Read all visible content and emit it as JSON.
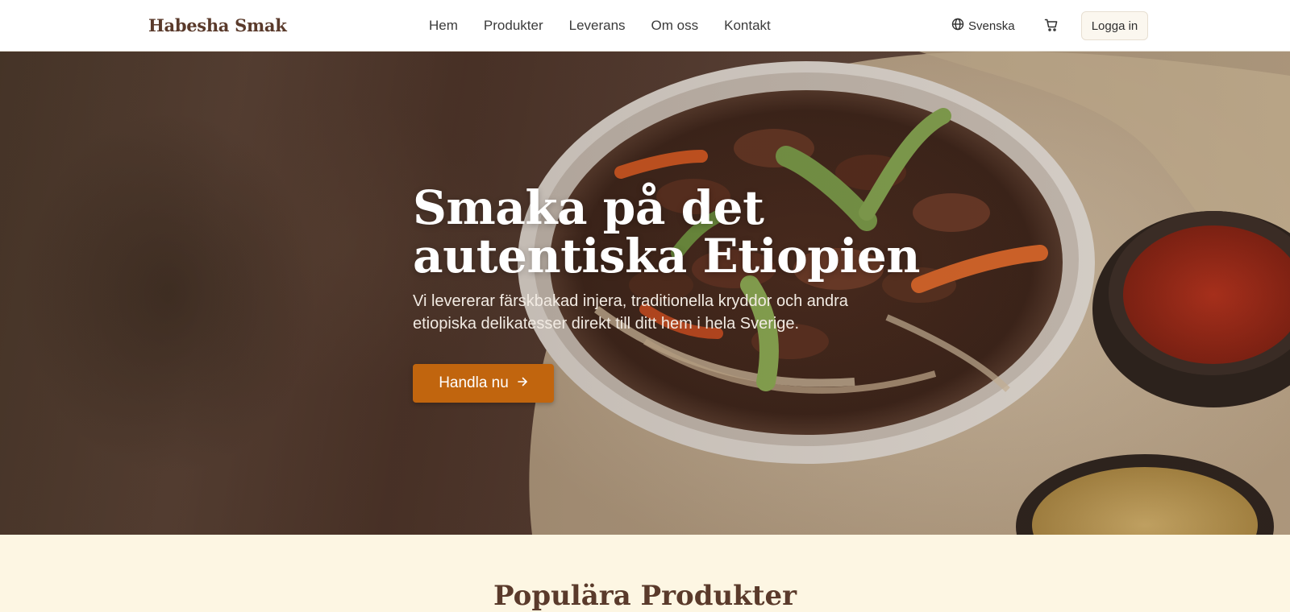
{
  "header": {
    "logo": "Habesha Smak",
    "nav": [
      "Hem",
      "Produkter",
      "Leverans",
      "Om oss",
      "Kontakt"
    ],
    "language": "Svenska",
    "language_icon": "globe-icon",
    "cart_icon": "cart-icon",
    "login": "Logga in"
  },
  "hero": {
    "title_line1": "Smaka på det",
    "title_line2": "autentiska Etiopien",
    "subtitle": "Vi levererar färskbakad injera, traditionella kryddor och andra etiopiska delikatesser direkt till ditt hem i hela Sverige.",
    "cta": "Handla nu",
    "cta_icon": "arrow-right-icon"
  },
  "section": {
    "title": "Populära Produkter"
  },
  "colors": {
    "brand": "#5a3a2b",
    "accent": "#c1650e",
    "section_bg": "#fdf6e3"
  }
}
